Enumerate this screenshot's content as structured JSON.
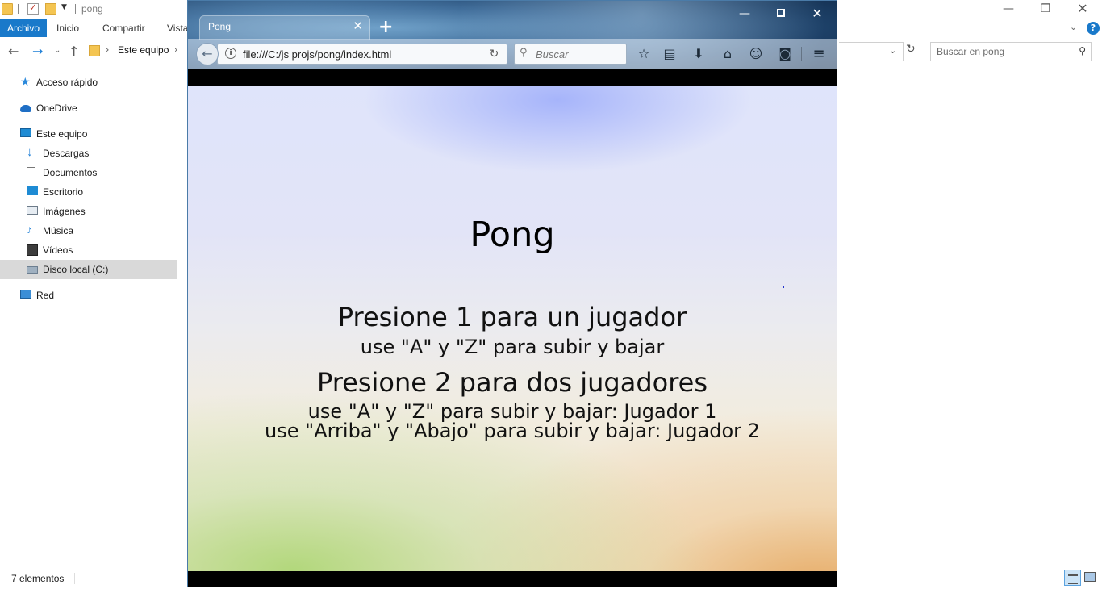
{
  "explorer": {
    "title": "pong",
    "window_buttons": {
      "minimize": "—",
      "restore": "❐",
      "close": "✕"
    },
    "ribbon": {
      "tabs": [
        "Archivo",
        "Inicio",
        "Compartir",
        "Vista"
      ],
      "help": "?"
    },
    "address": {
      "crumb": "Este equipo",
      "separator": "›",
      "search_placeholder": "Buscar en pong"
    },
    "nav_pane": {
      "items": [
        {
          "label": "Acceso rápido",
          "icon": "quick-access-star-icon"
        },
        {
          "label": "OneDrive",
          "icon": "onedrive-cloud-icon"
        },
        {
          "label": "Este equipo",
          "icon": "this-pc-icon"
        },
        {
          "label": "Descargas",
          "icon": "downloads-arrow-icon"
        },
        {
          "label": "Documentos",
          "icon": "documents-icon"
        },
        {
          "label": "Escritorio",
          "icon": "desktop-icon"
        },
        {
          "label": "Imágenes",
          "icon": "pictures-icon"
        },
        {
          "label": "Música",
          "icon": "music-note-icon"
        },
        {
          "label": "Vídeos",
          "icon": "videos-film-icon"
        },
        {
          "label": "Disco local (C:)",
          "icon": "local-disk-icon",
          "selected": true
        },
        {
          "label": "Red",
          "icon": "network-icon"
        }
      ]
    },
    "status": {
      "item_count": "7 elementos"
    }
  },
  "browser": {
    "tab": {
      "title": "Pong",
      "close": "✕"
    },
    "new_tab": "+",
    "window_buttons": {
      "minimize": "—",
      "close": "✕"
    },
    "url": "file:///C:/js projs/pong/index.html",
    "search_placeholder": "Buscar",
    "toolbar_icons": [
      "bookmark-star-icon",
      "reading-list-icon",
      "downloads-icon",
      "home-icon",
      "feedback-smiley-icon",
      "pocket-icon",
      "hamburger-menu-icon"
    ]
  },
  "game": {
    "title": "Pong",
    "option1_title": "Presione 1 para un jugador",
    "option1_desc": "use \"A\" y \"Z\" para subir y bajar",
    "option2_title": "Presione 2 para dos jugadores",
    "option2_desc1": "use \"A\" y \"Z\" para subir y bajar: Jugador 1",
    "option2_desc2": "use \"Arriba\" y \"Abajo\" para subir y bajar: Jugador 2"
  }
}
